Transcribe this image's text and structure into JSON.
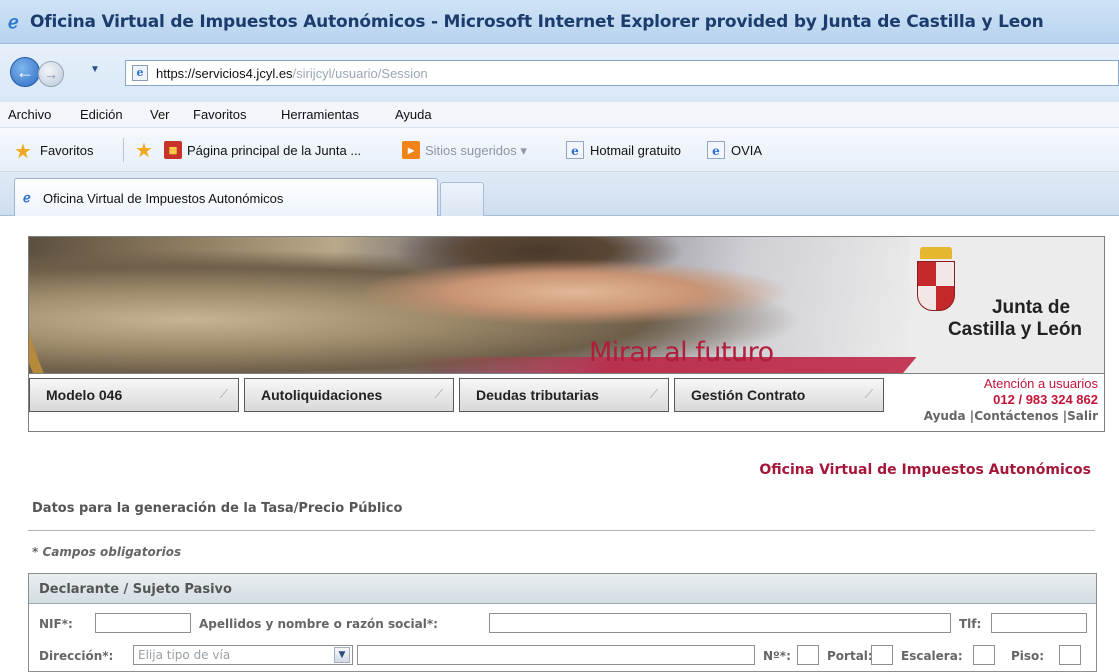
{
  "window": {
    "title": "Oficina Virtual de Impuestos Autonómicos - Microsoft Internet Explorer provided by Junta de Castilla y Leon"
  },
  "address_bar": {
    "url_scheme_host": "https://servicios4.jcyl.es",
    "url_path": "/sirijcyl/usuario/Session"
  },
  "menu": {
    "items": [
      "Archivo",
      "Edición",
      "Ver",
      "Favoritos",
      "Herramientas",
      "Ayuda"
    ]
  },
  "favorites_bar": {
    "favorites_label": "Favoritos",
    "items": [
      {
        "label": "Página principal de la Junta ...",
        "icon": "junta-icon"
      },
      {
        "label": "Sitios sugeridos ▾",
        "icon": "suggested-sites-icon"
      },
      {
        "label": "Hotmail gratuito",
        "icon": "ie-page-icon"
      },
      {
        "label": "OVIA",
        "icon": "ie-page-icon"
      }
    ]
  },
  "tabs": {
    "active_label": "Oficina Virtual de Impuestos Autonómicos"
  },
  "banner": {
    "slogan": "Mirar al futuro",
    "brand_line1": "Junta de",
    "brand_line2": "Castilla y León"
  },
  "nav": {
    "items": [
      "Modelo 046",
      "Autoliquidaciones",
      "Deudas tributarias",
      "Gestión Contrato"
    ],
    "support_title": "Atención a usuarios",
    "support_phone": "012 / 983 324 862",
    "link_help": "Ayuda",
    "link_contact": "Contáctenos",
    "link_exit": "Salir"
  },
  "page": {
    "office_title": "Oficina Virtual de Impuestos Autonómicos",
    "subtitle": "Datos para la generación de la Tasa/Precio Público",
    "required_note": "* Campos obligatorios"
  },
  "form": {
    "section_title": "Declarante / Sujeto Pasivo",
    "nif_label": "NIF*:",
    "name_label": "Apellidos y nombre o razón social*:",
    "phone_label": "Tlf:",
    "address_label": "Dirección*:",
    "street_type_placeholder": "Elija tipo de vía",
    "number_label": "Nº*:",
    "portal_label": "Portal:",
    "stair_label": "Escalera:",
    "floor_label": "Piso:"
  },
  "colors": {
    "brand_red": "#b21d3a",
    "ie_blue": "#2a6fd1"
  }
}
